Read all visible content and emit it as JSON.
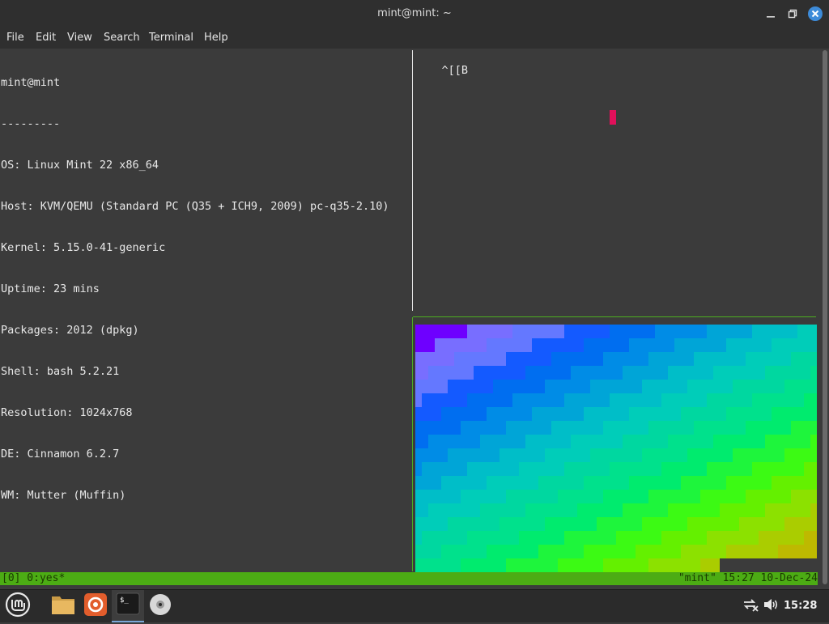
{
  "window": {
    "title": "mint@mint: ~"
  },
  "menu": {
    "items": [
      {
        "label": "File"
      },
      {
        "label": "Edit"
      },
      {
        "label": "View"
      },
      {
        "label": "Search"
      },
      {
        "label": "Terminal"
      },
      {
        "label": "Help"
      }
    ]
  },
  "terminal": {
    "left_lines": [
      "mint@mint",
      "---------",
      "OS: Linux Mint 22 x86_64",
      "Host: KVM/QEMU (Standard PC (Q35 + ICH9, 2009) pc-q35-2.10)",
      "Kernel: 5.15.0-41-generic",
      "Uptime: 23 mins",
      "Packages: 2012 (dpkg)",
      "Shell: bash 5.2.21",
      "Resolution: 1024x768",
      "DE: Cinnamon 6.2.7",
      "WM: Mutter (Muffin)"
    ],
    "right_top_text": "^[[B",
    "cursor_color": "#e0105a"
  },
  "status_bar": {
    "left": "[0] 0:yes*",
    "right": "\"mint\" 15:27 10-Dec-24",
    "color": "#4cac14"
  },
  "taskbar": {
    "apps": [
      {
        "name": "mint-menu-icon"
      },
      {
        "name": "files-icon"
      },
      {
        "name": "firefox-icon"
      },
      {
        "name": "terminal-icon"
      },
      {
        "name": "disc-icon"
      }
    ],
    "clock": "15:28"
  },
  "colors": {
    "accent_blue": "#3d8bd9",
    "tmux_green": "#4cac14"
  }
}
